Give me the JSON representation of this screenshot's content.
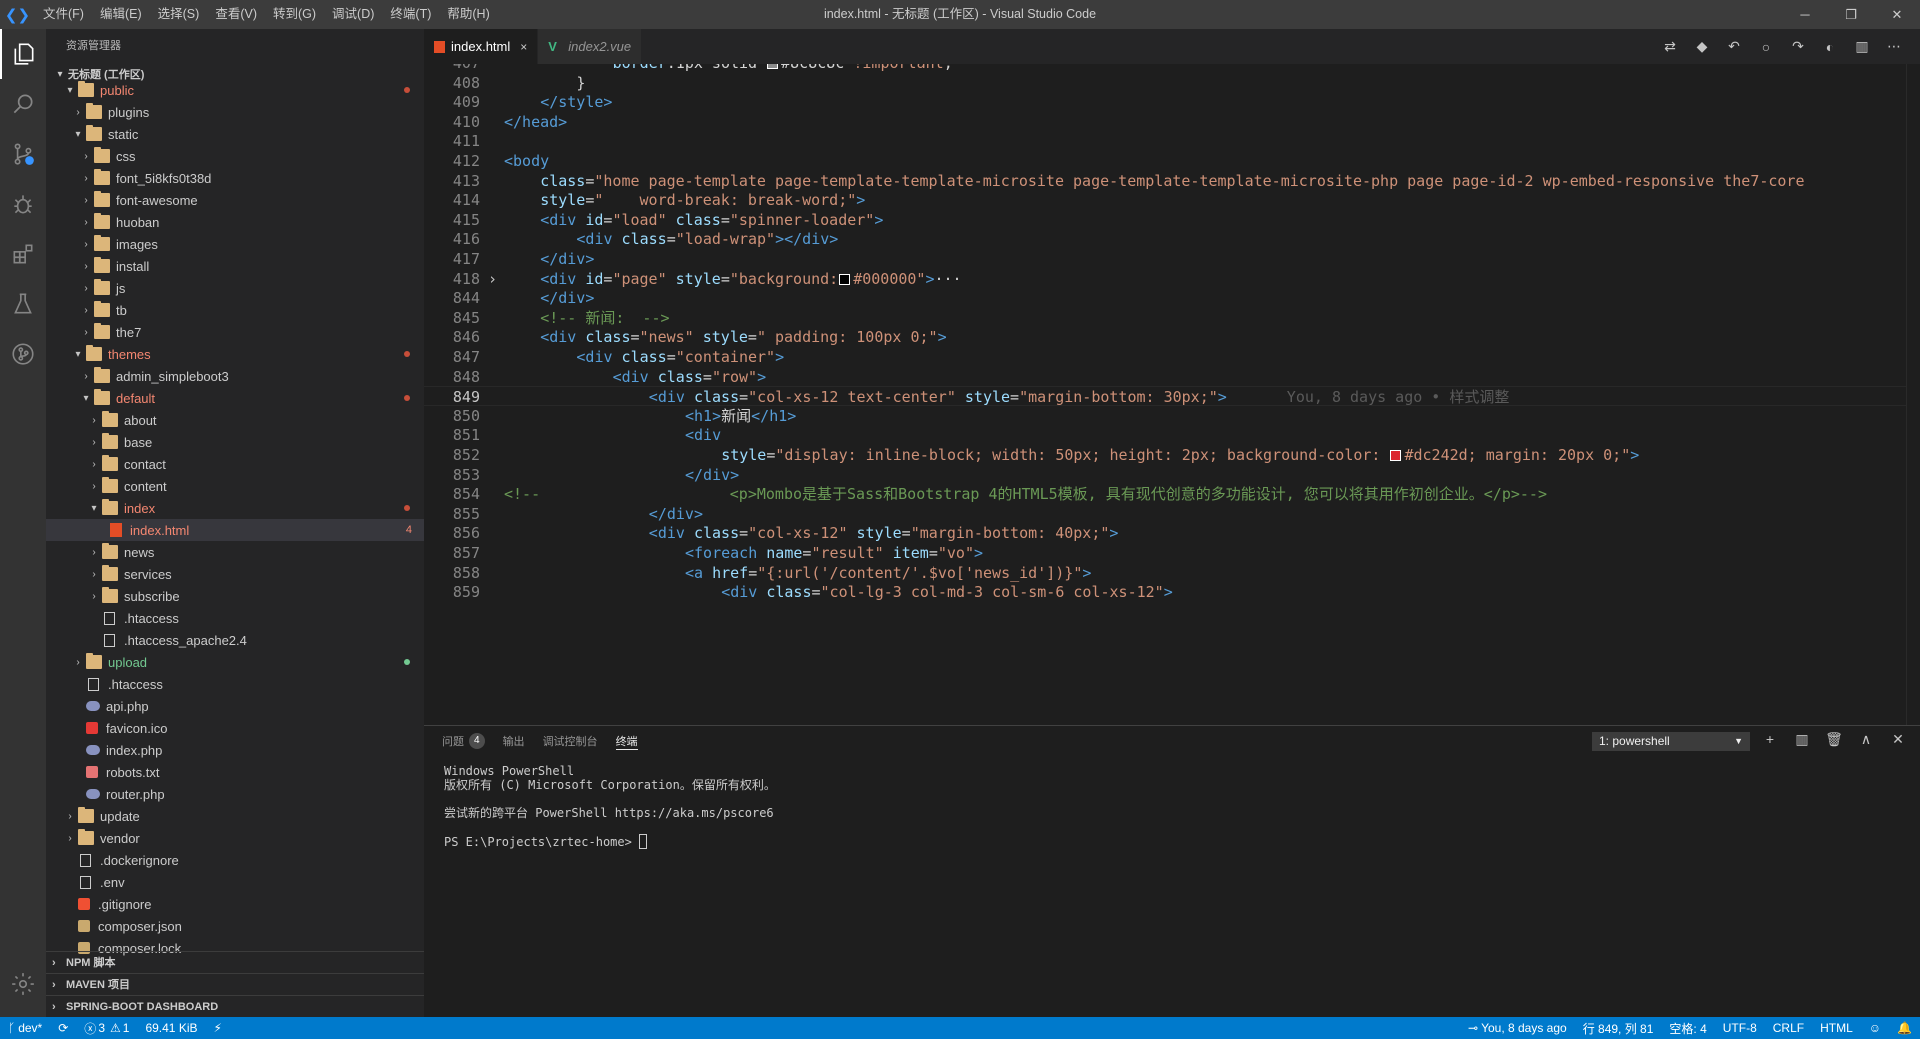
{
  "titlebar": {
    "logo": "❮❯",
    "menu": [
      "文件(F)",
      "编辑(E)",
      "选择(S)",
      "查看(V)",
      "转到(G)",
      "调试(D)",
      "终端(T)",
      "帮助(H)"
    ],
    "title": "index.html - 无标题 (工作区) - Visual Studio Code",
    "minimize": "─",
    "restore": "❐",
    "close": "✕"
  },
  "sidebar": {
    "title": "资源管理器",
    "workspace": "无标题 (工作区)",
    "tree": [
      {
        "label": "public",
        "type": "folder",
        "depth": 1,
        "open": true,
        "state": "err",
        "dot": "red"
      },
      {
        "label": "plugins",
        "type": "folder",
        "depth": 2,
        "open": false
      },
      {
        "label": "static",
        "type": "folder",
        "depth": 2,
        "open": true
      },
      {
        "label": "css",
        "type": "folder",
        "depth": 3,
        "open": false
      },
      {
        "label": "font_5i8kfs0t38d",
        "type": "folder",
        "depth": 3,
        "open": false
      },
      {
        "label": "font-awesome",
        "type": "folder",
        "depth": 3,
        "open": false
      },
      {
        "label": "huoban",
        "type": "folder",
        "depth": 3,
        "open": false
      },
      {
        "label": "images",
        "type": "folder",
        "depth": 3,
        "open": false
      },
      {
        "label": "install",
        "type": "folder",
        "depth": 3,
        "open": false
      },
      {
        "label": "js",
        "type": "folder",
        "depth": 3,
        "open": false
      },
      {
        "label": "tb",
        "type": "folder",
        "depth": 3,
        "open": false
      },
      {
        "label": "the7",
        "type": "folder",
        "depth": 3,
        "open": false
      },
      {
        "label": "themes",
        "type": "folder",
        "depth": 2,
        "open": true,
        "state": "err",
        "dot": "red"
      },
      {
        "label": "admin_simpleboot3",
        "type": "folder",
        "depth": 3,
        "open": false
      },
      {
        "label": "default",
        "type": "folder",
        "depth": 3,
        "open": true,
        "state": "err",
        "dot": "red"
      },
      {
        "label": "about",
        "type": "folder",
        "depth": 4,
        "open": false
      },
      {
        "label": "base",
        "type": "folder",
        "depth": 4,
        "open": false
      },
      {
        "label": "contact",
        "type": "folder",
        "depth": 4,
        "open": false
      },
      {
        "label": "content",
        "type": "folder",
        "depth": 4,
        "open": false
      },
      {
        "label": "index",
        "type": "folder",
        "depth": 4,
        "open": true,
        "state": "err",
        "dot": "red"
      },
      {
        "label": "index.html",
        "type": "html",
        "depth": 5,
        "state": "err",
        "count": "4",
        "selected": true
      },
      {
        "label": "news",
        "type": "folder",
        "depth": 4,
        "open": false
      },
      {
        "label": "services",
        "type": "folder",
        "depth": 4,
        "open": false
      },
      {
        "label": "subscribe",
        "type": "folder",
        "depth": 4,
        "open": false
      },
      {
        "label": ".htaccess",
        "type": "file",
        "depth": 4
      },
      {
        "label": ".htaccess_apache2.4",
        "type": "file",
        "depth": 4
      },
      {
        "label": "upload",
        "type": "folder",
        "depth": 2,
        "open": false,
        "state": "add",
        "dot": "green"
      },
      {
        "label": ".htaccess",
        "type": "file",
        "depth": 2
      },
      {
        "label": "api.php",
        "type": "php",
        "depth": 2
      },
      {
        "label": "favicon.ico",
        "type": "star",
        "depth": 2
      },
      {
        "label": "index.php",
        "type": "php",
        "depth": 2
      },
      {
        "label": "robots.txt",
        "type": "robot",
        "depth": 2
      },
      {
        "label": "router.php",
        "type": "php",
        "depth": 2
      },
      {
        "label": "update",
        "type": "folder",
        "depth": 1,
        "open": false
      },
      {
        "label": "vendor",
        "type": "folder",
        "depth": 1,
        "open": false
      },
      {
        "label": ".dockerignore",
        "type": "file",
        "depth": 1
      },
      {
        "label": ".env",
        "type": "file",
        "depth": 1
      },
      {
        "label": ".gitignore",
        "type": "git",
        "depth": 1
      },
      {
        "label": "composer.json",
        "type": "composer",
        "depth": 1
      },
      {
        "label": "composer.lock",
        "type": "composer",
        "depth": 1
      }
    ],
    "sections": [
      "NPM 脚本",
      "MAVEN 项目",
      "SPRING-BOOT DASHBOARD"
    ]
  },
  "tabs": [
    {
      "label": "index.html",
      "active": true,
      "close": "×"
    },
    {
      "label": "index2.vue",
      "active": false,
      "close": ""
    }
  ],
  "editor_actions": [
    "⇄",
    "◆",
    "↶",
    "○",
    "↷",
    "◐",
    "▥",
    "⋯"
  ],
  "editor": {
    "lines": [
      {
        "n": "407",
        "indent": 6,
        "parts": [
          [
            "att",
            "border"
          ],
          [
            "txt",
            ":1px solid "
          ],
          [
            "swatch",
            "#8c8c8c"
          ],
          [
            "txt",
            "#8c8c8c "
          ],
          [
            "str",
            "!important"
          ],
          [
            "txt",
            ";"
          ]
        ]
      },
      {
        "n": "408",
        "indent": 4,
        "parts": [
          [
            "txt",
            "}"
          ]
        ]
      },
      {
        "n": "409",
        "indent": 2,
        "parts": [
          [
            "tag",
            "</style>"
          ]
        ]
      },
      {
        "n": "410",
        "indent": 0,
        "parts": [
          [
            "tag",
            "</head>"
          ]
        ]
      },
      {
        "n": "411",
        "indent": 0,
        "parts": []
      },
      {
        "n": "412",
        "indent": 0,
        "parts": [
          [
            "tag",
            "<body"
          ]
        ]
      },
      {
        "n": "413",
        "indent": 2,
        "parts": [
          [
            "att",
            "class"
          ],
          [
            "txt",
            "="
          ],
          [
            "str",
            "\"home page-template page-template-template-microsite page-template-template-microsite-php page page-id-2 wp-embed-responsive the7-core"
          ]
        ]
      },
      {
        "n": "414",
        "indent": 2,
        "parts": [
          [
            "att",
            "style"
          ],
          [
            "txt",
            "="
          ],
          [
            "str",
            "\"    word-break: break-word;\""
          ],
          [
            "tag",
            ">"
          ]
        ]
      },
      {
        "n": "415",
        "indent": 2,
        "parts": [
          [
            "tag",
            "<div "
          ],
          [
            "att",
            "id"
          ],
          [
            "txt",
            "="
          ],
          [
            "str",
            "\"load\" "
          ],
          [
            "att",
            "class"
          ],
          [
            "txt",
            "="
          ],
          [
            "str",
            "\"spinner-loader\""
          ],
          [
            "tag",
            ">"
          ]
        ]
      },
      {
        "n": "416",
        "indent": 4,
        "parts": [
          [
            "tag",
            "<div "
          ],
          [
            "att",
            "class"
          ],
          [
            "txt",
            "="
          ],
          [
            "str",
            "\"load-wrap\""
          ],
          [
            "tag",
            "></div>"
          ]
        ]
      },
      {
        "n": "417",
        "indent": 2,
        "parts": [
          [
            "tag",
            "</div>"
          ]
        ]
      },
      {
        "n": "418",
        "indent": 2,
        "fold": true,
        "parts": [
          [
            "tag",
            "<div "
          ],
          [
            "att",
            "id"
          ],
          [
            "txt",
            "="
          ],
          [
            "str",
            "\"page\" "
          ],
          [
            "att",
            "style"
          ],
          [
            "txt",
            "="
          ],
          [
            "str",
            "\"background:"
          ],
          [
            "swatch",
            "#000000"
          ],
          [
            "str",
            "#000000\""
          ],
          [
            "tag",
            ">"
          ],
          [
            "txt",
            "···"
          ]
        ]
      },
      {
        "n": "844",
        "indent": 2,
        "parts": [
          [
            "tag",
            "</div>"
          ]
        ]
      },
      {
        "n": "845",
        "indent": 2,
        "parts": [
          [
            "cmt",
            "<!-- 新闻:  -->"
          ]
        ]
      },
      {
        "n": "846",
        "indent": 2,
        "parts": [
          [
            "tag",
            "<div "
          ],
          [
            "att",
            "class"
          ],
          [
            "txt",
            "="
          ],
          [
            "str",
            "\"news\" "
          ],
          [
            "att",
            "style"
          ],
          [
            "txt",
            "="
          ],
          [
            "str",
            "\" padding: 100px 0;\""
          ],
          [
            "tag",
            ">"
          ]
        ]
      },
      {
        "n": "847",
        "indent": 4,
        "parts": [
          [
            "tag",
            "<div "
          ],
          [
            "att",
            "class"
          ],
          [
            "txt",
            "="
          ],
          [
            "str",
            "\"container\""
          ],
          [
            "tag",
            ">"
          ]
        ]
      },
      {
        "n": "848",
        "indent": 6,
        "parts": [
          [
            "tag",
            "<div "
          ],
          [
            "att",
            "class"
          ],
          [
            "txt",
            "="
          ],
          [
            "str",
            "\"row\""
          ],
          [
            "tag",
            ">"
          ]
        ]
      },
      {
        "n": "849",
        "indent": 8,
        "current": true,
        "parts": [
          [
            "tag",
            "<div "
          ],
          [
            "att",
            "class"
          ],
          [
            "txt",
            "="
          ],
          [
            "str",
            "\"col-xs-12 text-center\" "
          ],
          [
            "att",
            "style"
          ],
          [
            "txt",
            "="
          ],
          [
            "str",
            "\"margin-bottom: 30px;\""
          ],
          [
            "tag",
            ">"
          ],
          [
            "blame",
            "You, 8 days ago • 样式调整"
          ]
        ]
      },
      {
        "n": "850",
        "indent": 10,
        "parts": [
          [
            "tag",
            "<h1>"
          ],
          [
            "txt",
            "新闻"
          ],
          [
            "tag",
            "</h1>"
          ]
        ]
      },
      {
        "n": "851",
        "indent": 10,
        "parts": [
          [
            "tag",
            "<div"
          ]
        ]
      },
      {
        "n": "852",
        "indent": 12,
        "parts": [
          [
            "att",
            "style"
          ],
          [
            "txt",
            "="
          ],
          [
            "str",
            "\"display: inline-block; width: 50px; height: 2px; background-color: "
          ],
          [
            "swatch",
            "#dc242d"
          ],
          [
            "str",
            "#dc242d; margin: 20px 0;\""
          ],
          [
            "tag",
            ">"
          ]
        ]
      },
      {
        "n": "853",
        "indent": 10,
        "parts": [
          [
            "tag",
            "</div>"
          ]
        ]
      },
      {
        "n": "854",
        "indent": 0,
        "parts": [
          [
            "cmt",
            "<!--                     <p>Mombo是基于Sass和Bootstrap 4的HTML5模板, 具有现代创意的多功能设计, 您可以将其用作初创企业。</p>-->"
          ]
        ]
      },
      {
        "n": "855",
        "indent": 8,
        "parts": [
          [
            "tag",
            "</div>"
          ]
        ]
      },
      {
        "n": "856",
        "indent": 8,
        "parts": [
          [
            "tag",
            "<div "
          ],
          [
            "att",
            "class"
          ],
          [
            "txt",
            "="
          ],
          [
            "str",
            "\"col-xs-12\" "
          ],
          [
            "att",
            "style"
          ],
          [
            "txt",
            "="
          ],
          [
            "str",
            "\"margin-bottom: 40px;\""
          ],
          [
            "tag",
            ">"
          ]
        ]
      },
      {
        "n": "857",
        "indent": 10,
        "parts": [
          [
            "tag",
            "<foreach "
          ],
          [
            "att",
            "name"
          ],
          [
            "txt",
            "="
          ],
          [
            "str",
            "\"result\" "
          ],
          [
            "att",
            "item"
          ],
          [
            "txt",
            "="
          ],
          [
            "str",
            "\"vo\""
          ],
          [
            "tag",
            ">"
          ]
        ]
      },
      {
        "n": "858",
        "indent": 10,
        "parts": [
          [
            "tag",
            "<a "
          ],
          [
            "att",
            "href"
          ],
          [
            "txt",
            "="
          ],
          [
            "str",
            "\"{:url('/content/'.$vo['news_id'])}\""
          ],
          [
            "tag",
            ">"
          ]
        ]
      },
      {
        "n": "859",
        "indent": 12,
        "parts": [
          [
            "tag",
            "<div "
          ],
          [
            "att",
            "class"
          ],
          [
            "txt",
            "="
          ],
          [
            "str",
            "\"col-lg-3 col-md-3 col-sm-6 col-xs-12\""
          ],
          [
            "tag",
            ">"
          ]
        ]
      }
    ]
  },
  "panel": {
    "tabs": [
      {
        "label": "问题",
        "badge": "4"
      },
      {
        "label": "输出"
      },
      {
        "label": "调试控制台"
      },
      {
        "label": "终端",
        "active": true
      }
    ],
    "terminal_select": "1: powershell",
    "actions": [
      "+",
      "▥",
      "🗑",
      "∧",
      "✕"
    ],
    "terminal_lines": [
      "Windows PowerShell",
      "版权所有 (C) Microsoft Corporation。保留所有权利。",
      "",
      "尝试新的跨平台 PowerShell https://aka.ms/pscore6",
      "",
      "PS E:\\Projects\\zrtec-home> "
    ]
  },
  "statusbar": {
    "branch": "dev*",
    "sync": "⟳",
    "errors": "3",
    "warnings": "1",
    "size": "69.41 KiB",
    "lightning": "⚡",
    "blame": "You, 8 days ago",
    "position": "行 849, 列 81",
    "spaces": "空格: 4",
    "encoding": "UTF-8",
    "eol": "CRLF",
    "language": "HTML",
    "feedback": "☺",
    "bell": "🔔"
  },
  "colors": {
    "accent": "#007acc",
    "title_bar": "#3c3c3c",
    "activity_bar": "#333333",
    "sidebar": "#252526",
    "editor": "#1e1e1e"
  },
  "activity_icons": [
    "files-icon",
    "search-icon",
    "source-control-icon",
    "debug-icon",
    "extensions-icon",
    "test-icon",
    "git-graph-icon"
  ]
}
